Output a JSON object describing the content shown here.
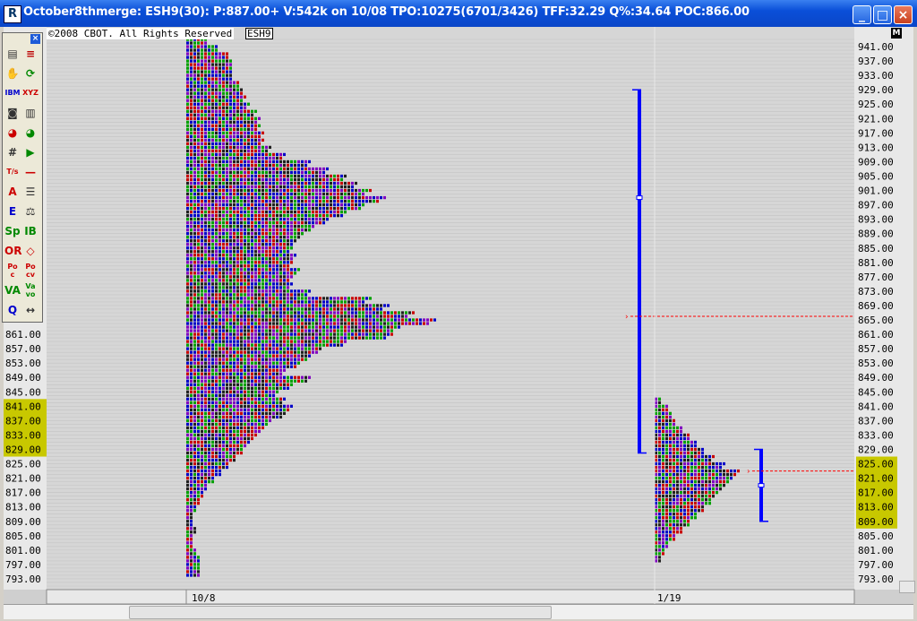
{
  "window": {
    "title": "October8thmerge: ESH9(30): P:887.00+ V:542k on 10/08 TPO:10275(6701/3426) TFF:32.29 Q%:34.64 POC:866.00",
    "minimize_label": "_",
    "maximize_label": "□",
    "close_label": "×"
  },
  "overlay": {
    "copyright": "©2008 CBOT. All Rights Reserved",
    "symbol": "ESH9",
    "corner_badge": "M"
  },
  "toolbox": {
    "close_label": "×",
    "tools": [
      {
        "name": "tpo-icon",
        "label": "▤",
        "color": "#333"
      },
      {
        "name": "letters-icon",
        "label": "≡",
        "color": "#b00"
      },
      {
        "name": "hand-icon",
        "label": "✋",
        "color": "#333"
      },
      {
        "name": "refresh-icon",
        "label": "⟳",
        "color": "#080"
      },
      {
        "name": "ibm-icon",
        "label": "IBM",
        "color": "#00c"
      },
      {
        "name": "xyz-icon",
        "label": "XYZ",
        "color": "#c00"
      },
      {
        "name": "camera-icon",
        "label": "◙",
        "color": "#333"
      },
      {
        "name": "notes-icon",
        "label": "▥",
        "color": "#333"
      },
      {
        "name": "color-wheel-icon",
        "label": "◕",
        "color": "#c00"
      },
      {
        "name": "color-wheel2-icon",
        "label": "◕",
        "color": "#080"
      },
      {
        "name": "grid-icon",
        "label": "#",
        "color": "#333"
      },
      {
        "name": "play-icon",
        "label": "▶",
        "color": "#080"
      },
      {
        "name": "ts-icon",
        "label": "T/s",
        "color": "#c00"
      },
      {
        "name": "line-icon",
        "label": "—",
        "color": "#c00"
      },
      {
        "name": "text-icon",
        "label": "A",
        "color": "#c00"
      },
      {
        "name": "align-icon",
        "label": "☰",
        "color": "#333"
      },
      {
        "name": "profile-icon",
        "label": "E",
        "color": "#00c"
      },
      {
        "name": "scale-icon",
        "label": "⚖",
        "color": "#333"
      },
      {
        "name": "sp-icon",
        "label": "Sp",
        "color": "#080"
      },
      {
        "name": "ib-icon",
        "label": "IB",
        "color": "#080"
      },
      {
        "name": "or-icon",
        "label": "OR",
        "color": "#c00"
      },
      {
        "name": "diamond-icon",
        "label": "◇",
        "color": "#c00"
      },
      {
        "name": "poc-icon",
        "label": "Po c",
        "color": "#c00"
      },
      {
        "name": "pocv-icon",
        "label": "Po cv",
        "color": "#c00"
      },
      {
        "name": "va-icon",
        "label": "VA",
        "color": "#080"
      },
      {
        "name": "vavo-icon",
        "label": "Va vo",
        "color": "#080"
      },
      {
        "name": "zoom-icon",
        "label": "Q",
        "color": "#00c"
      },
      {
        "name": "arrows-icon",
        "label": "↔",
        "color": "#333"
      }
    ]
  },
  "colors": {
    "tpo": [
      "#0000c8",
      "#c80000",
      "#00a000",
      "#8000c0",
      "#202020"
    ],
    "value_area_highlight": "#c8c800",
    "range_bar": "#0000ff",
    "poc_line": "#ff0000"
  },
  "chart_data": {
    "type": "market-profile",
    "ylim": [
      791,
      943
    ],
    "y_step": 4,
    "axis_tick_labels": [
      "941.00",
      "937.00",
      "933.00",
      "929.00",
      "925.00",
      "921.00",
      "917.00",
      "913.00",
      "909.00",
      "905.00",
      "901.00",
      "897.00",
      "893.00",
      "889.00",
      "885.00",
      "881.00",
      "877.00",
      "873.00",
      "869.00",
      "865.00",
      "861.00",
      "857.00",
      "853.00",
      "849.00",
      "845.00",
      "841.00",
      "837.00",
      "833.00",
      "829.00",
      "825.00",
      "821.00",
      "817.00",
      "813.00",
      "809.00",
      "805.00",
      "801.00",
      "797.00",
      "793.00"
    ],
    "left_axis_labels": [
      "861.00",
      "857.00",
      "853.00",
      "849.00",
      "845.00",
      "841.00",
      "837.00",
      "833.00",
      "829.00",
      "825.00",
      "821.00",
      "817.00",
      "813.00",
      "809.00",
      "805.00",
      "801.00",
      "797.00",
      "793.00"
    ],
    "left_highlight_range": [
      829,
      841
    ],
    "right_highlight_range": [
      809,
      825
    ],
    "x_labels": [
      "10/8",
      "1/19"
    ],
    "profiles": [
      {
        "date": "10/8",
        "poc": 866,
        "range": [
          795,
          943
        ],
        "range_bar": {
          "low": 828,
          "high": 929,
          "mid": 899
        },
        "widths": [
          [
            943,
            6
          ],
          [
            941,
            9
          ],
          [
            939,
            12
          ],
          [
            937,
            13
          ],
          [
            935,
            13
          ],
          [
            933,
            13
          ],
          [
            931,
            15
          ],
          [
            929,
            16
          ],
          [
            927,
            17
          ],
          [
            925,
            18
          ],
          [
            923,
            20
          ],
          [
            921,
            21
          ],
          [
            919,
            21
          ],
          [
            917,
            22
          ],
          [
            915,
            22
          ],
          [
            913,
            24
          ],
          [
            911,
            28
          ],
          [
            909,
            35
          ],
          [
            907,
            40
          ],
          [
            905,
            45
          ],
          [
            903,
            48
          ],
          [
            901,
            52
          ],
          [
            899,
            56
          ],
          [
            897,
            50
          ],
          [
            895,
            45
          ],
          [
            893,
            40
          ],
          [
            891,
            36
          ],
          [
            889,
            33
          ],
          [
            887,
            31
          ],
          [
            885,
            30
          ],
          [
            883,
            31
          ],
          [
            881,
            30
          ],
          [
            879,
            32
          ],
          [
            877,
            30
          ],
          [
            875,
            30
          ],
          [
            873,
            35
          ],
          [
            871,
            52
          ],
          [
            869,
            57
          ],
          [
            867,
            64
          ],
          [
            865,
            70
          ],
          [
            863,
            60
          ],
          [
            861,
            58
          ],
          [
            859,
            45
          ],
          [
            857,
            38
          ],
          [
            855,
            35
          ],
          [
            853,
            32
          ],
          [
            851,
            28
          ],
          [
            849,
            35
          ],
          [
            847,
            30
          ],
          [
            845,
            26
          ],
          [
            843,
            28
          ],
          [
            841,
            30
          ],
          [
            839,
            28
          ],
          [
            837,
            24
          ],
          [
            835,
            22
          ],
          [
            833,
            20
          ],
          [
            831,
            18
          ],
          [
            829,
            16
          ],
          [
            827,
            14
          ],
          [
            825,
            12
          ],
          [
            823,
            10
          ],
          [
            821,
            8
          ],
          [
            819,
            6
          ],
          [
            817,
            5
          ],
          [
            815,
            4
          ],
          [
            813,
            3
          ],
          [
            811,
            2
          ],
          [
            809,
            2
          ],
          [
            807,
            3
          ],
          [
            805,
            2
          ],
          [
            803,
            2
          ],
          [
            801,
            3
          ],
          [
            799,
            4
          ],
          [
            797,
            4
          ],
          [
            795,
            4
          ]
        ]
      },
      {
        "date": "1/19",
        "poc": 823,
        "range": [
          799,
          843
        ],
        "range_bar": {
          "low": 809,
          "high": 829,
          "mid": 819
        },
        "widths": [
          [
            843,
            2
          ],
          [
            841,
            4
          ],
          [
            839,
            5
          ],
          [
            837,
            6
          ],
          [
            835,
            8
          ],
          [
            833,
            10
          ],
          [
            831,
            12
          ],
          [
            829,
            14
          ],
          [
            827,
            17
          ],
          [
            825,
            20
          ],
          [
            823,
            24
          ],
          [
            821,
            22
          ],
          [
            819,
            20
          ],
          [
            817,
            18
          ],
          [
            815,
            16
          ],
          [
            813,
            14
          ],
          [
            811,
            12
          ],
          [
            809,
            10
          ],
          [
            807,
            8
          ],
          [
            805,
            6
          ],
          [
            803,
            4
          ],
          [
            801,
            3
          ],
          [
            799,
            2
          ]
        ]
      }
    ]
  }
}
